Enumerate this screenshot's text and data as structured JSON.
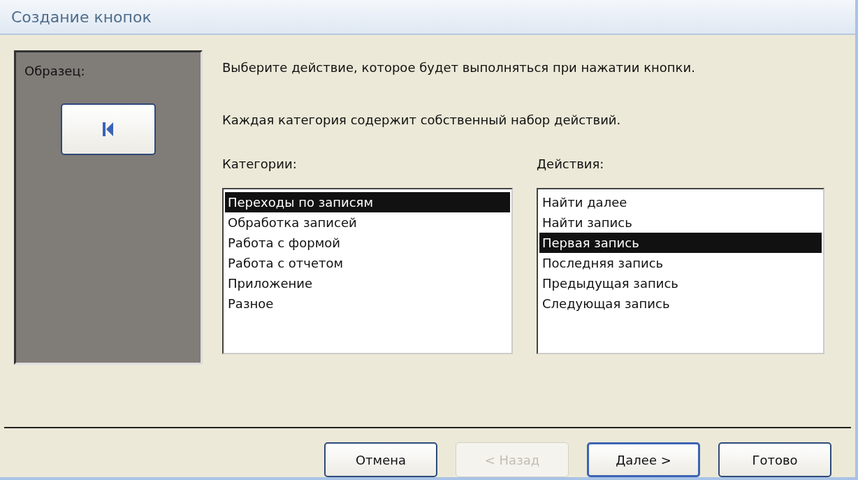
{
  "window": {
    "title": "Создание кнопок"
  },
  "sample": {
    "label": "Образец:"
  },
  "instructions": [
    "Выберите действие, которое будет выполняться при нажатии кнопки.",
    "Каждая категория содержит собственный набор действий."
  ],
  "categories": {
    "label": "Категории:",
    "items": [
      {
        "text": "Переходы по записям",
        "selected": true
      },
      {
        "text": "Обработка записей",
        "selected": false
      },
      {
        "text": "Работа с формой",
        "selected": false
      },
      {
        "text": "Работа с отчетом",
        "selected": false
      },
      {
        "text": "Приложение",
        "selected": false
      },
      {
        "text": "Разное",
        "selected": false
      }
    ]
  },
  "actions": {
    "label": "Действия:",
    "items": [
      {
        "text": "Найти далее",
        "selected": false
      },
      {
        "text": "Найти запись",
        "selected": false
      },
      {
        "text": "Первая запись",
        "selected": true
      },
      {
        "text": "Последняя запись",
        "selected": false
      },
      {
        "text": "Предыдущая запись",
        "selected": false
      },
      {
        "text": "Следующая запись",
        "selected": false
      }
    ]
  },
  "buttons": [
    {
      "label": "Отмена",
      "disabled": false,
      "default": false
    },
    {
      "label": "< Назад",
      "disabled": true,
      "default": false
    },
    {
      "label": "Далее >",
      "disabled": false,
      "default": true
    },
    {
      "label": "Готово",
      "disabled": false,
      "default": false
    }
  ]
}
